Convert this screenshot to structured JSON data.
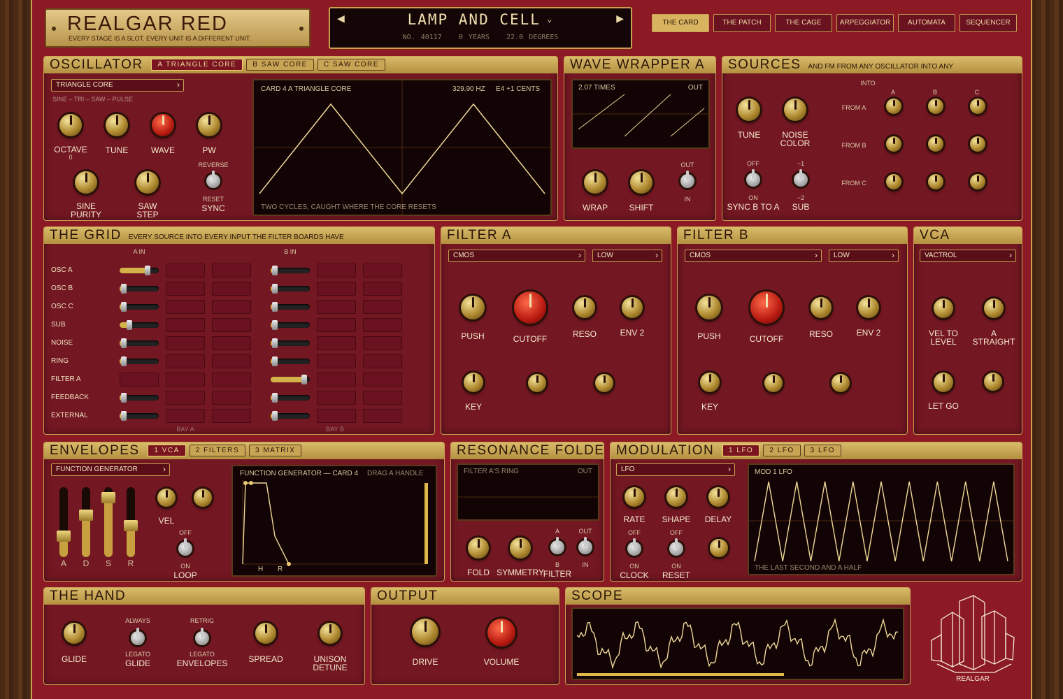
{
  "brand": {
    "title": "REALGAR RED",
    "tagline": "EVERY STAGE IS A SLOT. EVERY UNIT IS A DIFFERENT UNIT.",
    "logo_label": "REALGAR"
  },
  "preset": {
    "name": "LAMP AND CELL",
    "number": "NO. 40117",
    "years": "0 YEARS",
    "degrees": "22.0 DEGREES"
  },
  "nav": [
    "THE CARD",
    "THE PATCH",
    "THE CAGE",
    "ARPEGGIATOR",
    "AUTOMATA",
    "SEQUENCER"
  ],
  "osc": {
    "title": "OSCILLATOR",
    "tabs": [
      "A  TRIANGLE CORE",
      "B  SAW CORE",
      "C  SAW CORE"
    ],
    "select": "TRIANGLE CORE",
    "shapes": "SINE – TRI – SAW – PULSE",
    "k": [
      "OCTAVE",
      "TUNE",
      "WAVE",
      "PW",
      "SINE\nPURITY",
      "SAW\nSTEP"
    ],
    "octave_val": "0",
    "reverse": "REVERSE",
    "reset": "RESET",
    "sync": "SYNC",
    "screen_left": "CARD 4  A  TRIANGLE CORE",
    "screen_freq": "329.90 HZ",
    "screen_note": "E4 +1 CENTS",
    "screen_foot": "TWO CYCLES, CAUGHT WHERE THE CORE RESETS"
  },
  "wave": {
    "title": "WAVE WRAPPER A",
    "times": "2.07 TIMES",
    "out": "OUT",
    "wrap": "WRAP",
    "shift": "SHIFT",
    "t_out": "OUT",
    "t_in": "IN"
  },
  "sources": {
    "title": "SOURCES",
    "sub": "AND FM FROM ANY OSCILLATOR INTO ANY",
    "tune": "TUNE",
    "noise": "NOISE\nCOLOR",
    "into": "INTO",
    "cols": [
      "A",
      "B",
      "C"
    ],
    "rows": [
      "FROM A",
      "FROM B",
      "FROM C"
    ],
    "off": "OFF",
    "on": "ON",
    "sync": "SYNC B TO A",
    "m1": "−1",
    "m2": "−2",
    "sub_l": "SUB"
  },
  "grid": {
    "title": "THE GRID",
    "sub": "EVERY SOURCE INTO EVERY INPUT THE FILTER BOARDS HAVE",
    "a_in": "A IN",
    "b_in": "B IN",
    "rows": [
      "OSC A",
      "OSC B",
      "OSC C",
      "SUB",
      "NOISE",
      "RING",
      "FILTER A",
      "FEEDBACK",
      "EXTERNAL"
    ],
    "bay_a": "BAY A",
    "bay_b": "BAY B",
    "a_levels": [
      0.72,
      0.1,
      0.1,
      0.25,
      0.1,
      0.1,
      null,
      0.1,
      0.1
    ],
    "b_levels": [
      0.1,
      0.1,
      0.1,
      0.1,
      0.1,
      0.1,
      0.85,
      0.1,
      0.1
    ]
  },
  "filter_a": {
    "title": "FILTER A",
    "type": "CMOS",
    "mode": "LOW",
    "push": "PUSH",
    "cutoff": "CUTOFF",
    "reso": "RESO",
    "env": "ENV 2",
    "key": "KEY"
  },
  "filter_b": {
    "title": "FILTER B",
    "type": "CMOS",
    "mode": "LOW",
    "push": "PUSH",
    "cutoff": "CUTOFF",
    "reso": "RESO",
    "env": "ENV 2",
    "key": "KEY"
  },
  "vca": {
    "title": "VCA",
    "type": "VACTROL",
    "vel": "VEL TO\nLEVEL",
    "straight": "A\nSTRAIGHT",
    "letgo": "LET GO"
  },
  "env": {
    "title": "ENVELOPES",
    "tabs": [
      "1  VCA",
      "2  FILTERS",
      "3  MATRIX"
    ],
    "select": "FUNCTION GENERATOR",
    "faders": [
      "A",
      "D",
      "S",
      "R"
    ],
    "fader_levels": [
      0.3,
      0.6,
      0.85,
      0.45
    ],
    "vel": "VEL",
    "off": "OFF",
    "on": "ON",
    "loop": "LOOP",
    "screen_t": "FUNCTION GENERATOR  —  CARD 4",
    "screen_r": "DRAG A HANDLE",
    "h": "H",
    "r": "R"
  },
  "res": {
    "title": "RESONANCE FOLDER",
    "src": "FILTER A'S RING",
    "out": "OUT",
    "fold": "FOLD",
    "sym": "SYMMETRY",
    "filter": "FILTER",
    "a": "A",
    "b": "B",
    "t_out": "OUT",
    "t_in": "IN"
  },
  "mod": {
    "title": "MODULATION",
    "tabs": [
      "1  LFO",
      "2  LFO",
      "3  LFO"
    ],
    "select": "LFO",
    "rate": "RATE",
    "shape": "SHAPE",
    "delay": "DELAY",
    "off": "OFF",
    "on": "ON",
    "clock": "CLOCK",
    "reset": "RESET",
    "screen_t": "MOD 1  LFO",
    "screen_f": "THE LAST SECOND AND A HALF"
  },
  "hand": {
    "title": "THE HAND",
    "glide": "GLIDE",
    "always": "ALWAYS",
    "legato": "LEGATO",
    "glide2": "GLIDE",
    "retrig": "RETRIG",
    "legato2": "LEGATO",
    "envs": "ENVELOPES",
    "spread": "SPREAD",
    "unison": "UNISON\nDETUNE"
  },
  "output": {
    "title": "OUTPUT",
    "drive": "DRIVE",
    "volume": "VOLUME"
  },
  "scope": {
    "title": "SCOPE",
    "level": 0.74
  }
}
